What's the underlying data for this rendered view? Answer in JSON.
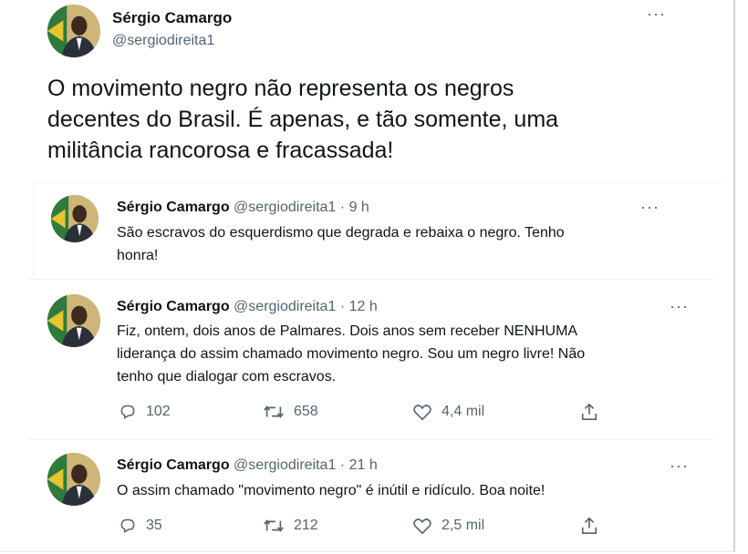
{
  "main_tweet": {
    "author_name": "Sérgio Camargo",
    "author_handle": "@sergiodireita1",
    "text_line1": "O movimento negro não representa os negros",
    "text_line2": "decentes do Brasil. É apenas, e tão somente, uma",
    "text_line3": "militância rancorosa e fracassada!",
    "more_icon": "more-horizontal-icon"
  },
  "quoted_tweet": {
    "author_name": "Sérgio Camargo",
    "author_handle": "@sergiodireita1",
    "separator": "·",
    "time": "9 h",
    "text_line1": "São escravos do esquerdismo que degrada e rebaixa o negro. Tenho",
    "text_line2": "honra!"
  },
  "tweets": [
    {
      "author_name": "Sérgio Camargo",
      "author_handle": "@sergiodireita1",
      "separator": "·",
      "time": "12 h",
      "text_line1": "Fiz, ontem, dois anos de Palmares. Dois anos sem receber NENHUMA",
      "text_line2": "liderança do assim chamado movimento negro. Sou um negro livre! Não",
      "text_line3": "tenho que dialogar com escravos.",
      "replies": "102",
      "retweets": "658",
      "likes": "4,4 mil"
    },
    {
      "author_name": "Sérgio Camargo",
      "author_handle": "@sergiodireita1",
      "separator": "·",
      "time": "21 h",
      "text_line1": "O assim chamado \"movimento negro\" é inútil e ridículo. Boa noite!",
      "replies": "35",
      "retweets": "212",
      "likes": "2,5 mil"
    }
  ],
  "colors": {
    "text": "#0f1419",
    "muted": "#536471",
    "divider": "#eff3f4",
    "border": "#cfd4d8"
  },
  "icons": [
    "reply-icon",
    "retweet-icon",
    "like-icon",
    "share-icon",
    "more-horizontal-icon"
  ]
}
